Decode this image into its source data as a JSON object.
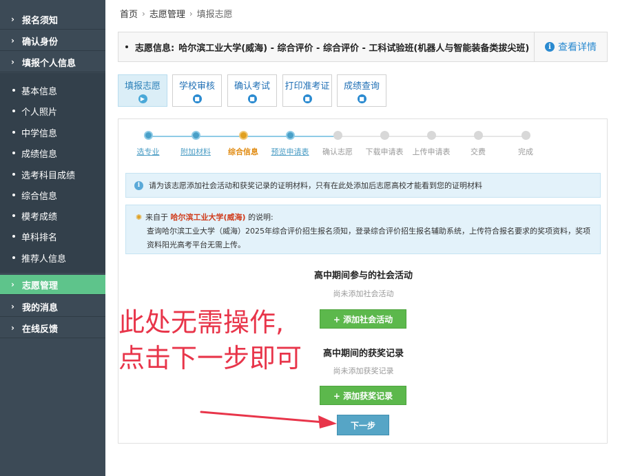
{
  "sidebar": {
    "main_items": [
      {
        "label": "报名须知"
      },
      {
        "label": "确认身份"
      },
      {
        "label": "填报个人信息"
      }
    ],
    "sub_items": [
      {
        "label": "基本信息"
      },
      {
        "label": "个人照片"
      },
      {
        "label": "中学信息"
      },
      {
        "label": "成绩信息"
      },
      {
        "label": "选考科目成绩"
      },
      {
        "label": "综合信息"
      },
      {
        "label": "模考成绩"
      },
      {
        "label": "单科排名"
      },
      {
        "label": "推荐人信息"
      }
    ],
    "bottom_items": [
      {
        "label": "志愿管理",
        "active": true
      },
      {
        "label": "我的消息"
      },
      {
        "label": "在线反馈"
      }
    ]
  },
  "breadcrumb": {
    "home": "首页",
    "section": "志愿管理",
    "current": "填报志愿"
  },
  "infobar": {
    "label": "志愿信息:",
    "value": "哈尔滨工业大学(威海) - 综合评价 - 综合评价 - 工科试验班(机器人与智能装备类拔尖班)",
    "detail_label": "查看详情"
  },
  "tabs": [
    {
      "label": "填报志愿",
      "active": true
    },
    {
      "label": "学校审核"
    },
    {
      "label": "确认考试"
    },
    {
      "label": "打印准考证"
    },
    {
      "label": "成绩查询"
    }
  ],
  "steps": [
    {
      "label": "选专业",
      "state": "done"
    },
    {
      "label": "附加材料",
      "state": "done"
    },
    {
      "label": "综合信息",
      "state": "current"
    },
    {
      "label": "预览申请表",
      "state": "done"
    },
    {
      "label": "确认志愿",
      "state": "pending"
    },
    {
      "label": "下载申请表",
      "state": "pending"
    },
    {
      "label": "上传申请表",
      "state": "pending"
    },
    {
      "label": "交费",
      "state": "pending"
    },
    {
      "label": "完成",
      "state": "pending"
    }
  ],
  "notice1": {
    "text": "请为该志愿添加社会活动和获奖记录的证明材料，只有在此处添加后志愿高校才能看到您的证明材料"
  },
  "notice2": {
    "prefix": "来自于",
    "school": "哈尔滨工业大学(威海)",
    "suffix": "的说明:",
    "body": "查询哈尔滨工业大学（威海）2025年综合评价招生报名须知，登录综合评价招生报名辅助系统，上传符合报名要求的奖项资料，奖项资料阳光高考平台无需上传。"
  },
  "social": {
    "title": "高中期间参与的社会活动",
    "empty": "尚未添加社会活动",
    "button": "+ 添加社会活动"
  },
  "awards": {
    "title": "高中期间的获奖记录",
    "empty": "尚未添加获奖记录",
    "button": "+ 添加获奖记录"
  },
  "next_button": "下一步",
  "annotation": {
    "line1": "此处无需操作,",
    "line2": "点击下一步即可"
  },
  "colors": {
    "sidebar_bg": "#3c4a56",
    "active_green": "#5ec48b",
    "link_blue": "#2a8ad0",
    "button_green": "#5cb84c",
    "next_blue": "#56a5c6",
    "annotation_red": "#e8354a",
    "current_step_orange": "#e0a020"
  }
}
